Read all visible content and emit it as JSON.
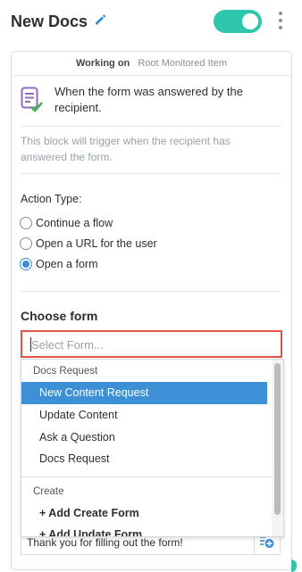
{
  "header": {
    "title": "New Docs",
    "edit_icon": "pencil-icon",
    "toggle_on": true,
    "toggle_color": "#2ec7ab",
    "menu_icon": "kebab-menu-icon"
  },
  "working_on": {
    "label": "Working on",
    "value": "Root Monitored Item"
  },
  "trigger": {
    "icon": "form-check-icon",
    "line1": "When the form was answered by the",
    "line2": "recipient."
  },
  "description": {
    "line1": "This block will trigger when the recipient has",
    "line2": "answered the form."
  },
  "action": {
    "label": "Action Type:",
    "options": [
      {
        "label": "Continue a flow",
        "selected": false
      },
      {
        "label": "Open a URL for the user",
        "selected": false
      },
      {
        "label": "Open a form",
        "selected": true
      }
    ]
  },
  "choose_form": {
    "heading": "Choose form",
    "placeholder": "Select Form...",
    "highlight_color": "#e0534a"
  },
  "dropdown": {
    "group1": "Docs Request",
    "items1": [
      "New Content Request",
      "Update Content",
      "Ask a Question",
      "Docs Request"
    ],
    "selected_index": 0,
    "group2": "Create",
    "items2": [
      "+ Add Create Form",
      "+ Add Update Form"
    ],
    "selected_color": "#3d8fd6"
  },
  "message": {
    "value": "Thank you for filling out the form!",
    "add_icon": "insert-variable-icon"
  }
}
